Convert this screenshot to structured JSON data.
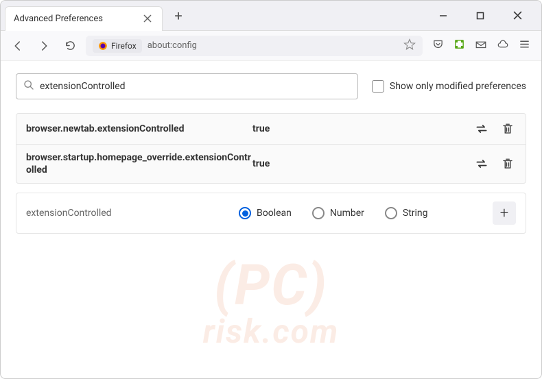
{
  "tab": {
    "title": "Advanced Preferences"
  },
  "addressbar": {
    "badge": "Firefox",
    "url": "about:config"
  },
  "search": {
    "value": "extensionControlled"
  },
  "checkbox": {
    "label": "Show only modified preferences"
  },
  "prefs": [
    {
      "name": "browser.newtab.extensionControlled",
      "value": "true"
    },
    {
      "name": "browser.startup.homepage_override.extensionControlled",
      "value": "true"
    }
  ],
  "create": {
    "name": "extensionControlled",
    "types": [
      "Boolean",
      "Number",
      "String"
    ],
    "selected": 0
  }
}
